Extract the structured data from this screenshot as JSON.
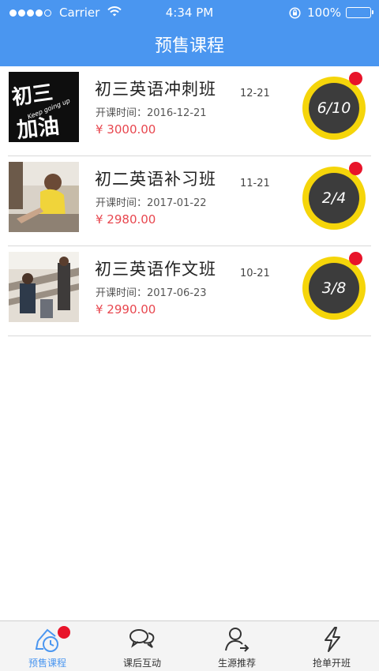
{
  "status_bar": {
    "carrier": "Carrier",
    "time": "4:34 PM",
    "battery": "100%"
  },
  "nav": {
    "title": "预售课程"
  },
  "courses": [
    {
      "name": "初三英语冲刺班",
      "date_short": "12-21",
      "start_label": "开课时间：",
      "start_date": "2016-12-21",
      "price": "¥ 3000.00",
      "enrolled": "6/10",
      "thumb_text_top": "初三",
      "thumb_text_sub": "Keep going up",
      "thumb_text_bottom": "加油"
    },
    {
      "name": "初二英语补习班",
      "date_short": "11-21",
      "start_label": "开课时间：",
      "start_date": "2017-01-22",
      "price": "¥ 2980.00",
      "enrolled": "2/4"
    },
    {
      "name": "初三英语作文班",
      "date_short": "10-21",
      "start_label": "开课时间：",
      "start_date": "2017-06-23",
      "price": "¥ 2990.00",
      "enrolled": "3/8"
    }
  ],
  "tabs": [
    {
      "label": "预售课程",
      "icon": "presale-clock-icon",
      "active": true
    },
    {
      "label": "课后互动",
      "icon": "chat-bubbles-icon",
      "active": false
    },
    {
      "label": "生源推荐",
      "icon": "user-recommend-icon",
      "active": false
    },
    {
      "label": "抢单开班",
      "icon": "lightning-icon",
      "active": false
    }
  ],
  "colors": {
    "primary": "#4a96f0",
    "price": "#e8474f",
    "badge_ring": "#f5d50a",
    "badge_center": "#3c3c3c",
    "notification": "#e8142a"
  }
}
